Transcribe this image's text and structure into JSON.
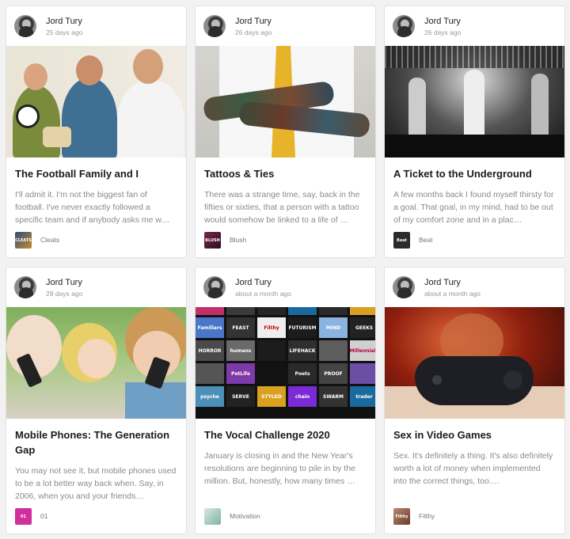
{
  "cards": [
    {
      "author": "Jord Tury",
      "time": "25 days ago",
      "title": "The Football Family and I",
      "excerpt": "I'll admit it. I'm not the biggest fan of football. I've never exactly followed a specific team and if anybody asks me w…",
      "tag": "Cleats",
      "tag_thumb_text": "CLEATS",
      "tag_color": "#3a5a80"
    },
    {
      "author": "Jord Tury",
      "time": "26 days ago",
      "title": "Tattoos & Ties",
      "excerpt": "There was a strange time, say, back in the fifties or sixties, that a person with a tattoo would somehow be linked to a life of …",
      "tag": "Blush",
      "tag_thumb_text": "BLUSH",
      "tag_color": "#5a2840"
    },
    {
      "author": "Jord Tury",
      "time": "26 days ago",
      "title": "A Ticket to the Underground",
      "excerpt": "A few months back I found myself thirsty for a goal. That goal, in my mind, had to be out of my comfort zone and in a plac…",
      "tag": "Beat",
      "tag_thumb_text": "Beat",
      "tag_color": "#2a2a2a"
    },
    {
      "author": "Jord Tury",
      "time": "28 days ago",
      "title": "Mobile Phones: The Generation Gap",
      "excerpt": "You may not see it, but mobile phones used to be a lot better way back when. Say, in 2006, when you and your friends…",
      "tag": "01",
      "tag_thumb_text": "01",
      "tag_color": "#d12f9c"
    },
    {
      "author": "Jord Tury",
      "time": "about a month ago",
      "title": "The Vocal Challenge 2020",
      "excerpt": "January is closing in and the New Year's resolutions are beginning to pile in by the million. But, honestly, how many times …",
      "tag": "Motivation",
      "tag_thumb_text": "",
      "tag_color": "#9bc4b8"
    },
    {
      "author": "Jord Tury",
      "time": "about a month ago",
      "title": "Sex in Video Games",
      "excerpt": "Sex. It's definitely a thing. It's also definitely worth a lot of money when implemented into the correct things, too.…",
      "tag": "Filthy",
      "tag_thumb_text": "Filthy",
      "tag_color": "#9b6a52"
    }
  ],
  "mosaic_labels": [
    "",
    "",
    "",
    "",
    "",
    "",
    "Familiars",
    "FEAST",
    "Filthy",
    "FUTURISM",
    "MIND",
    "GEEKS",
    "HORROR",
    "humans",
    "",
    "LIFEHACK",
    "",
    "Millennials",
    "",
    "PetLife",
    "",
    "Poets",
    "PROOF",
    "",
    "psyche",
    "SERVE",
    "STYLED",
    "chain",
    "SWARM",
    "trader"
  ]
}
